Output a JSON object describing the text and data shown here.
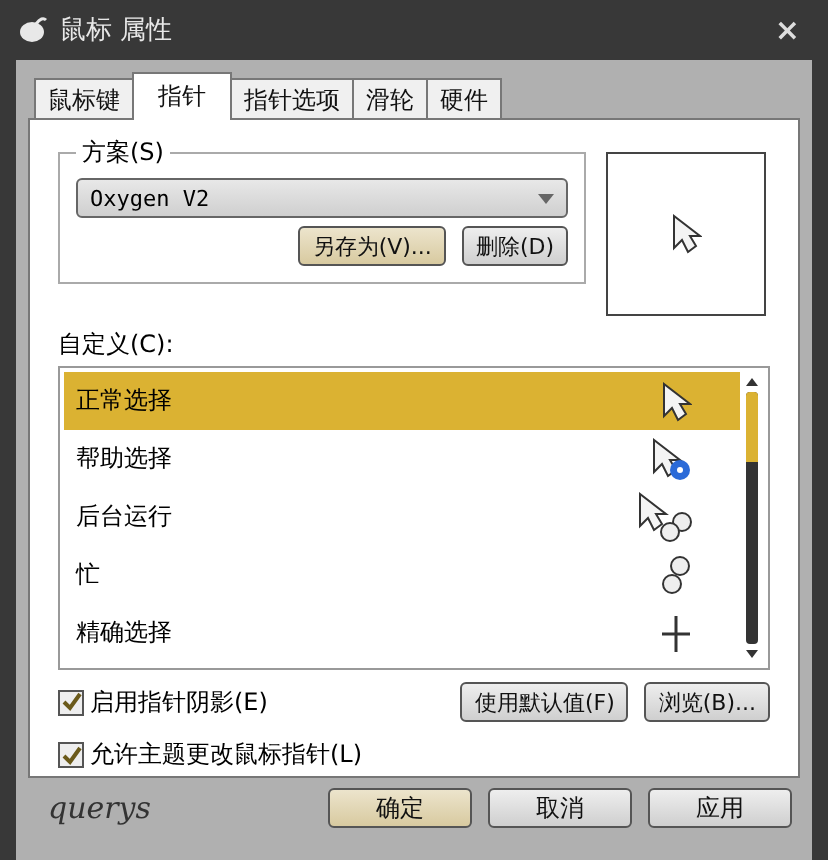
{
  "window": {
    "title": "鼠标 属性",
    "close": "×"
  },
  "tabs": [
    {
      "label": "鼠标键",
      "selected": false
    },
    {
      "label": "指针",
      "selected": true
    },
    {
      "label": "指针选项",
      "selected": false
    },
    {
      "label": "滑轮",
      "selected": false
    },
    {
      "label": "硬件",
      "selected": false
    }
  ],
  "scheme": {
    "legend": "方案(S)",
    "value": "Oxygen V2",
    "buttons": [
      "另存为(V)...",
      "删除(D)"
    ]
  },
  "customize": {
    "label": "自定义(C):",
    "items": [
      {
        "label": "正常选择",
        "kind": "arrow",
        "selected": true
      },
      {
        "label": "帮助选择",
        "kind": "help",
        "selected": false
      },
      {
        "label": "后台运行",
        "kind": "working",
        "selected": false
      },
      {
        "label": "忙",
        "kind": "busy",
        "selected": false
      },
      {
        "label": "精确选择",
        "kind": "precision",
        "selected": false
      }
    ]
  },
  "options": [
    {
      "label": "启用指针阴影(E)",
      "checked": true
    },
    {
      "label": "允许主题更改鼠标指针(L)",
      "checked": true
    }
  ],
  "list_buttons": [
    "使用默认值(F)",
    "浏览(B)..."
  ],
  "signature": "querys",
  "footer_buttons": [
    {
      "label": "确定",
      "selected": true
    },
    {
      "label": "取消",
      "selected": false
    },
    {
      "label": "应用",
      "selected": false
    }
  ]
}
